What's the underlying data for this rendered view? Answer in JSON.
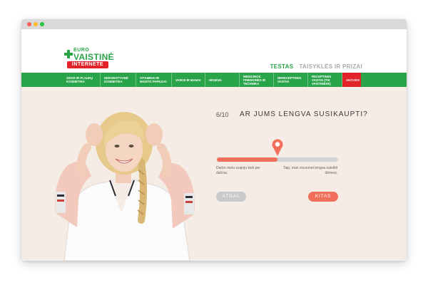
{
  "logo": {
    "euro": "EURO",
    "vaistine": "VAISTINĖ",
    "internete": "INTERNETE"
  },
  "top_nav": {
    "items": [
      {
        "label": "TESTAS"
      },
      {
        "label": "TAISYKLĖS IR PRIZAI"
      }
    ]
  },
  "menu": {
    "items": [
      {
        "label": "ODOS IR PLAUKŲ KOSMETIKA"
      },
      {
        "label": "DEKORATYVINĖ KOSMETIKA"
      },
      {
        "label": "VITAMINAI IR MAISTO PAPILDAI"
      },
      {
        "label": "VAIKUI IR MAMAI"
      },
      {
        "label": "HIGIENA"
      },
      {
        "label": "MEDICINOS PRIEMONĖS IR TECHNIKA"
      },
      {
        "label": "NERECEPTINIAI VAISTAI"
      },
      {
        "label": "RECEPTINIAI VAISTAI (TIK VAISTINĖSE)"
      },
      {
        "label": "AKCIJOS"
      }
    ]
  },
  "quiz": {
    "step": "6/10",
    "question": "AR JUMS LENGVA SUSIKAUPTI?",
    "slider_value": 0.5,
    "label_left": "Darbo metu svajoju kiek per dažnai.",
    "label_right": "Taip, man visuomet lengva sutelkti dėmesį.",
    "back_label": "ATGAL",
    "next_label": "KITAS"
  },
  "colors": {
    "brand_green": "#2aa44a",
    "brand_red": "#e2232a",
    "accent_coral": "#f26f5c",
    "hero_bg": "#f5ece6"
  }
}
